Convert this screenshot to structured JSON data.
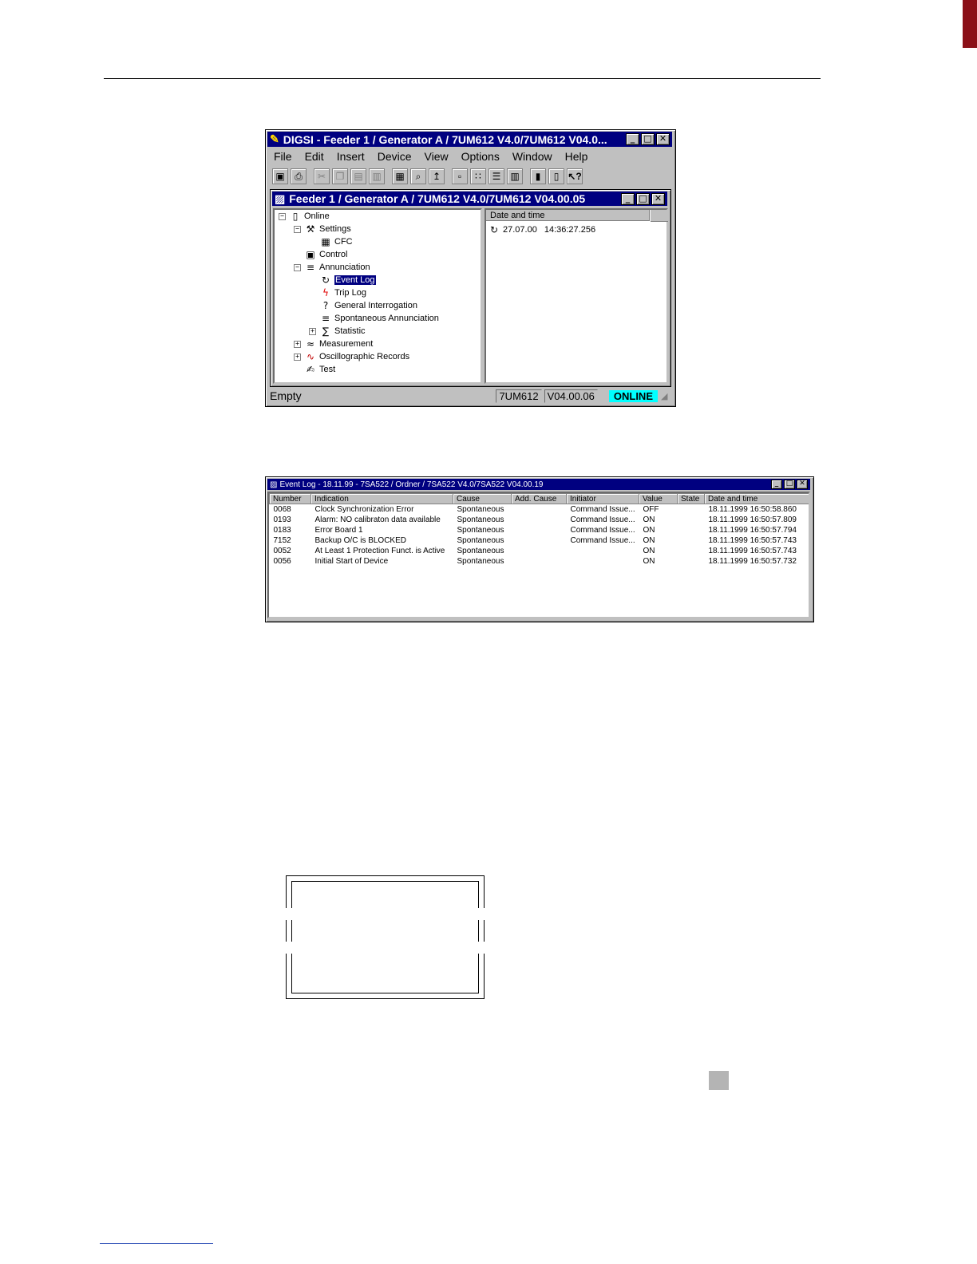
{
  "main_window": {
    "title": "DIGSI - Feeder 1 / Generator A / 7UM612 V4.0/7UM612 V04.0...",
    "menu": [
      "File",
      "Edit",
      "Insert",
      "Device",
      "View",
      "Options",
      "Window",
      "Help"
    ],
    "toolbar_icons": [
      "save-icon",
      "print-icon",
      "cut-icon",
      "copy-icon",
      "paste-icon",
      "paste-special-icon",
      "open-device-icon",
      "find-icon",
      "up-level-icon",
      "large-icons-icon",
      "small-icons-icon",
      "list-icon",
      "details-icon",
      "device-catalog-icon",
      "device-online-icon",
      "help-icon"
    ],
    "status": {
      "text": "Empty",
      "device": "7UM612",
      "version": "V04.00.06",
      "mode": "ONLINE"
    }
  },
  "child_window": {
    "title": "Feeder 1 / Generator A / 7UM612 V4.0/7UM612 V04.00.05",
    "tree": [
      {
        "label": "Online",
        "icon": "device-icon"
      },
      {
        "label": "Settings",
        "icon": "settings-icon"
      },
      {
        "label": "CFC",
        "icon": "cfc-icon"
      },
      {
        "label": "Control",
        "icon": "control-icon"
      },
      {
        "label": "Annunciation",
        "icon": "annunciation-icon"
      },
      {
        "label": "Event Log",
        "icon": "event-log-icon"
      },
      {
        "label": "Trip Log",
        "icon": "trip-icon"
      },
      {
        "label": "General Interrogation",
        "icon": "interrogation-icon"
      },
      {
        "label": "Spontaneous Annunciation",
        "icon": "spontaneous-icon"
      },
      {
        "label": "Statistic",
        "icon": "statistic-icon"
      },
      {
        "label": "Measurement",
        "icon": "measurement-icon"
      },
      {
        "label": "Oscillographic Records",
        "icon": "oscillograph-icon"
      },
      {
        "label": "Test",
        "icon": "test-icon"
      }
    ],
    "list_header": "Date and time",
    "list_rows": [
      {
        "date": "27.07.00",
        "time": "14:36:27.256"
      }
    ]
  },
  "event_log_window": {
    "title": "Event Log - 18.11.99 - 7SA522 / Ordner / 7SA522 V4.0/7SA522 V04.00.19",
    "columns": [
      "Number",
      "Indication",
      "Cause",
      "Add. Cause",
      "Initiator",
      "Value",
      "State",
      "Date and time"
    ],
    "rows": [
      [
        "0068",
        "Clock Synchronization Error",
        "Spontaneous",
        "",
        "Command Issue...",
        "OFF",
        "",
        "18.11.1999  16:50:58.860"
      ],
      [
        "0193",
        "Alarm: NO calibraton data available",
        "Spontaneous",
        "",
        "Command Issue...",
        "ON",
        "",
        "18.11.1999  16:50:57.809"
      ],
      [
        "0183",
        "Error Board 1",
        "Spontaneous",
        "",
        "Command Issue...",
        "ON",
        "",
        "18.11.1999  16:50:57.794"
      ],
      [
        "7152",
        "Backup O/C is BLOCKED",
        "Spontaneous",
        "",
        "Command Issue...",
        "ON",
        "",
        "18.11.1999  16:50:57.743"
      ],
      [
        "0052",
        "At Least 1 Protection Funct. is Active",
        "Spontaneous",
        "",
        "",
        "ON",
        "",
        "18.11.1999  16:50:57.743"
      ],
      [
        "0056",
        "Initial Start of Device",
        "Spontaneous",
        "",
        "",
        "ON",
        "",
        "18.11.1999  16:50:57.732"
      ]
    ]
  },
  "colors": {
    "title_bar": "#000080",
    "online_badge": "#00ffff",
    "page_tab": "#8b1018"
  }
}
